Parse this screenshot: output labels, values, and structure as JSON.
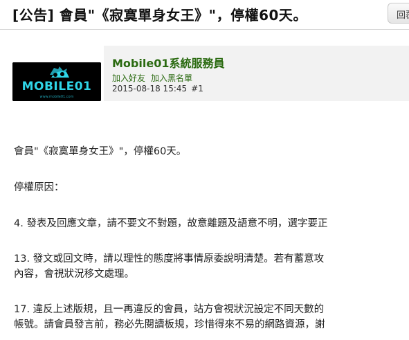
{
  "post": {
    "title": "[公告] 會員\"《寂寞單身女王》\"，停權60天。",
    "reply_button": "回覆"
  },
  "author": {
    "name": "Mobile01系統服務員",
    "add_friend": "加入好友",
    "add_blacklist": "加入黑名單",
    "timestamp": "2015-08-18 15:45",
    "floor": "#1",
    "avatar_text": "MOBILE01",
    "avatar_subtext": "www.mobile01.com"
  },
  "content": {
    "line1": "會員\"《寂寞單身女王》\"，停權60天。",
    "line2": "停權原因：",
    "line3": "4. 發表及回應文章，請不要文不對題，故意離題及語意不明，選字要正",
    "line4a": "13. 發文或回文時，請以理性的態度將事情原委說明清楚。若有蓄意攻",
    "line4b": "內容，會視狀況移文處理。",
    "line5a": "17. 違反上述版規，且一再違反的會員，站方會視狀況設定不同天數的",
    "line5b": "帳號。請會員發言前，務必先閱讀板規，珍惜得來不易的網路資源，謝"
  },
  "colors": {
    "author_green": "#2a6a10",
    "logo_cyan": "#2fd6e8",
    "author_bg": "#f2f2f2"
  }
}
